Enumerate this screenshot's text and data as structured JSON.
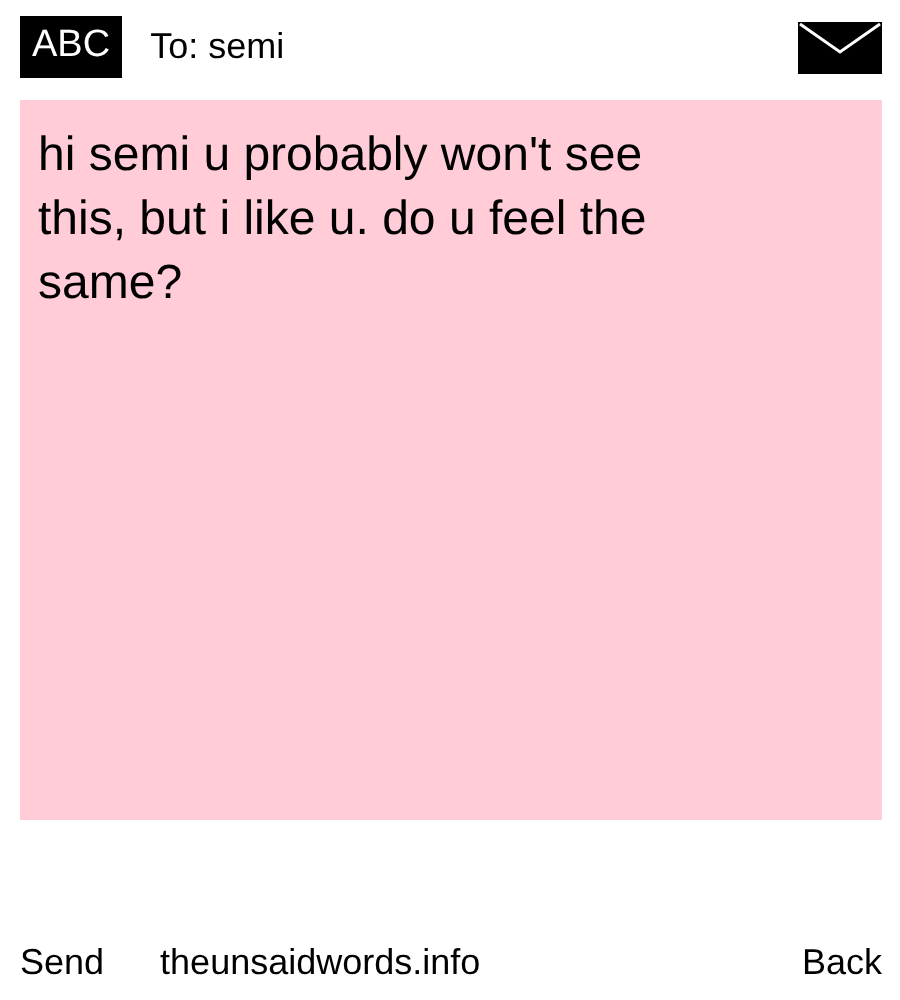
{
  "header": {
    "mode": "ABC",
    "recipient": "To: semi"
  },
  "message": {
    "text": "hi semi u probably won't see this, but i like u. do u feel the same?"
  },
  "footer": {
    "left": "Send",
    "center": "theunsaidwords.info",
    "right": "Back"
  }
}
